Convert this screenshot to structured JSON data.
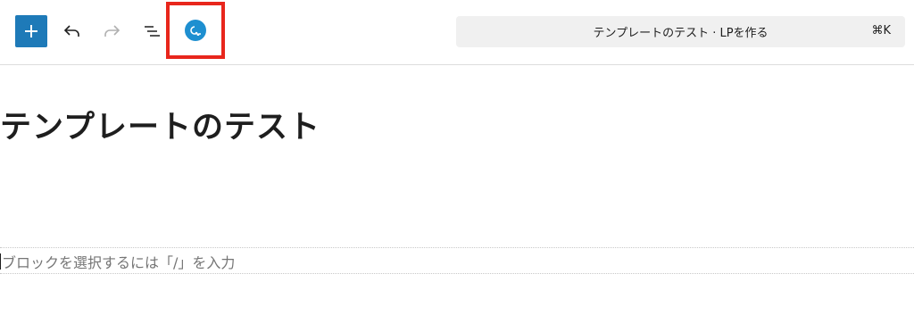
{
  "toolbar": {
    "add_icon": "plus-icon",
    "undo_icon": "undo-icon",
    "redo_icon": "redo-icon",
    "list_view_icon": "list-view-icon",
    "plugin_icon": "plugin-logo-icon",
    "highlight_color": "#e8261c",
    "accent_color": "#1e7ab8"
  },
  "command_bar": {
    "label": "テンプレートのテスト · LPを作る",
    "shortcut": "⌘K"
  },
  "editor": {
    "title": "テンプレートのテスト",
    "block_placeholder": "ブロックを選択するには「/」を入力"
  }
}
